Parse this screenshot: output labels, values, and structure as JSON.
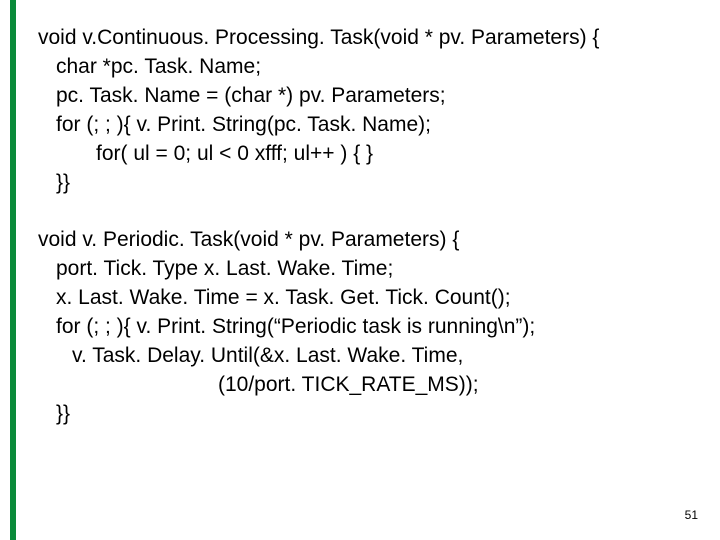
{
  "code": {
    "block1": {
      "l1": "void v.Continuous. Processing. Task(void * pv. Parameters) {",
      "l2": "char *pc. Task. Name;",
      "l3": "pc. Task. Name = (char *) pv. Parameters;",
      "l4": "for (; ; ){ v. Print. String(pc. Task. Name);",
      "l5": "for( ul = 0; ul < 0 xfff; ul++ ) { }",
      "l6": "}}"
    },
    "block2": {
      "l1": "void v. Periodic. Task(void * pv. Parameters) {",
      "l2": "port. Tick. Type x. Last. Wake. Time;",
      "l3": "x. Last. Wake. Time = x. Task. Get. Tick. Count();",
      "l4": "for (; ; ){ v. Print. String(“Periodic task is running\\n”);",
      "l5": "v. Task. Delay. Until(&x. Last. Wake. Time,",
      "l6": "(10/port. TICK_RATE_MS));",
      "l7": "}}"
    }
  },
  "page_number": "51"
}
